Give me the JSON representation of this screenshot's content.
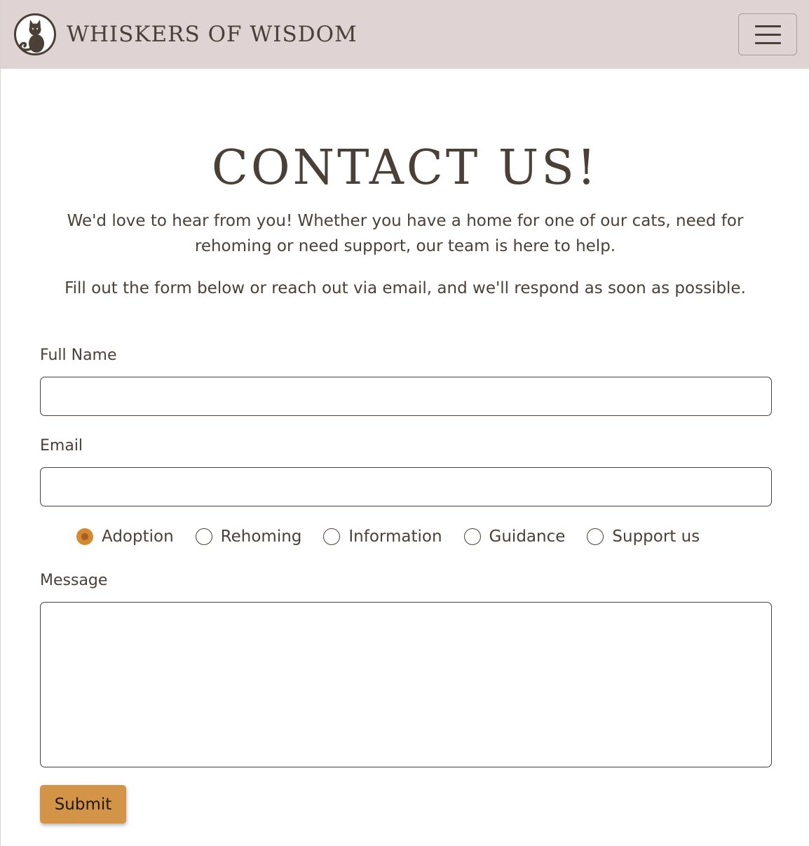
{
  "navbar": {
    "brand_name": "WHISKERS OF WISDOM",
    "logo_icon": "cat-logo-icon",
    "menu_icon": "hamburger-menu-icon"
  },
  "page": {
    "title": "CONTACT US!",
    "intro": "We'd love to hear from you! Whether you have a home for one of our cats, need for rehoming or need support, our team is here to help.",
    "intro_secondary": "Fill out the form below or reach out via email, and we'll respond as soon as possible."
  },
  "form": {
    "full_name": {
      "label": "Full Name",
      "value": "",
      "placeholder": ""
    },
    "email": {
      "label": "Email",
      "value": "",
      "placeholder": ""
    },
    "topics": [
      {
        "label": "Adoption",
        "checked": true
      },
      {
        "label": "Rehoming",
        "checked": false
      },
      {
        "label": "Information",
        "checked": false
      },
      {
        "label": "Guidance",
        "checked": false
      },
      {
        "label": "Support us",
        "checked": false
      }
    ],
    "message": {
      "label": "Message",
      "value": "",
      "placeholder": ""
    },
    "submit_label": "Submit"
  },
  "colors": {
    "navbar_bg": "#dfd4d3",
    "text": "#4a4037",
    "accent": "#d39447",
    "radio_checked": "#d58a31"
  }
}
